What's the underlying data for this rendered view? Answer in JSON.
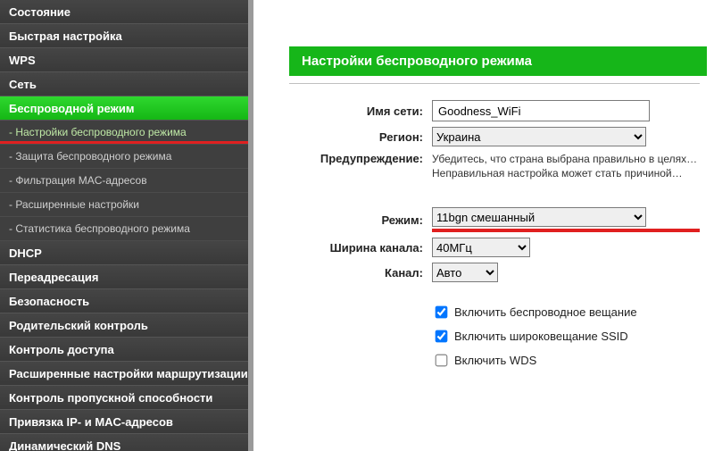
{
  "sidebar": {
    "items": [
      {
        "label": "Состояние",
        "type": "item"
      },
      {
        "label": "Быстрая настройка",
        "type": "item"
      },
      {
        "label": "WPS",
        "type": "item"
      },
      {
        "label": "Сеть",
        "type": "item"
      },
      {
        "label": "Беспроводной режим",
        "type": "item",
        "active": true
      },
      {
        "label": "- Настройки беспроводного режима",
        "type": "sub",
        "hl": true,
        "underline": true
      },
      {
        "label": "- Защита беспроводного режима",
        "type": "sub"
      },
      {
        "label": "- Фильтрация MAC-адресов",
        "type": "sub"
      },
      {
        "label": "- Расширенные настройки",
        "type": "sub"
      },
      {
        "label": "- Статистика беспроводного режима",
        "type": "sub"
      },
      {
        "label": "DHCP",
        "type": "item"
      },
      {
        "label": "Переадресация",
        "type": "item"
      },
      {
        "label": "Безопасность",
        "type": "item"
      },
      {
        "label": "Родительский контроль",
        "type": "item"
      },
      {
        "label": "Контроль доступа",
        "type": "item"
      },
      {
        "label": "Расширенные настройки маршрутизации",
        "type": "item"
      },
      {
        "label": "Контроль пропускной способности",
        "type": "item"
      },
      {
        "label": "Привязка IP- и MAC-адресов",
        "type": "item"
      },
      {
        "label": "Динамический DNS",
        "type": "item"
      }
    ]
  },
  "panel": {
    "title": "Настройки беспроводного режима"
  },
  "form": {
    "ssid_label": "Имя сети:",
    "ssid_value": "Goodness_WiFi",
    "region_label": "Регион:",
    "region_value": "Украина",
    "warn_label": "Предупреждение:",
    "warn_text": "Убедитесь, что страна выбрана правильно в целях… Неправильная настройка может стать причиной…",
    "mode_label": "Режим:",
    "mode_value": "11bgn смешанный",
    "cw_label": "Ширина канала:",
    "cw_value": "40МГц",
    "ch_label": "Канал:",
    "ch_value": "Авто",
    "chk1": "Включить беспроводное вещание",
    "chk2": "Включить широковещание SSID",
    "chk3": "Включить WDS"
  }
}
